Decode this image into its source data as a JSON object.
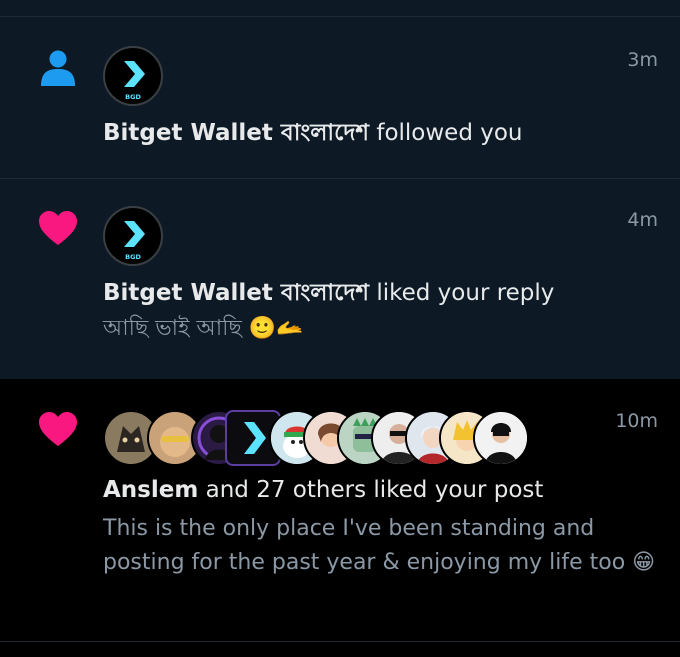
{
  "notifications": [
    {
      "type": "follow",
      "icon": "person-icon",
      "icon_color": "#1d9bf0",
      "time": "3m",
      "avatar_badge": "BGD",
      "actor": "Bitget Wallet বাংলাদেশ",
      "action": " followed you"
    },
    {
      "type": "like",
      "icon": "heart-icon",
      "icon_color": "#f91880",
      "time": "4m",
      "avatar_badge": "BGD",
      "actor": "Bitget Wallet বাংলাদেশ",
      "action": " liked your reply",
      "snippet": "আছি ভাই আছি 🙂🫴"
    },
    {
      "type": "like",
      "icon": "heart-icon",
      "icon_color": "#f91880",
      "time": "10m",
      "actor": "Anslem",
      "action": " and 27 others liked your post",
      "snippet": "This is the only place I've been standing and posting for the past year & enjoying my life too 😁"
    }
  ],
  "colors": {
    "unread_bg": "#0d1a26",
    "read_bg": "#000000",
    "accent_cyan": "#5be3ff",
    "muted_text": "#8b98a5"
  }
}
